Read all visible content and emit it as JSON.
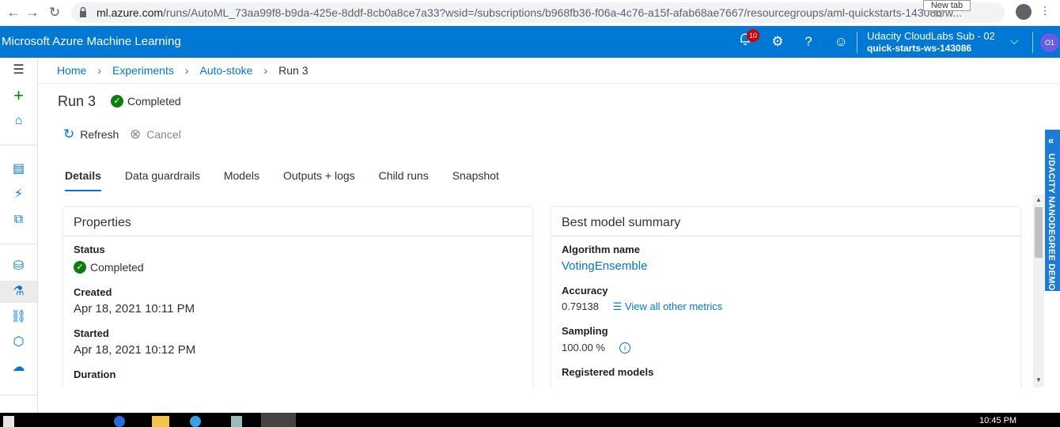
{
  "browser": {
    "url_domain": "ml.azure.com",
    "url_path": "/runs/AutoML_73aa99f8-b9da-425e-8ddf-8cb0a8ce7a33?wsid=/subscriptions/b968fb36-f06a-4c76-a15f-afab68ae7667/resourcegroups/aml-quickstarts-143086/w...",
    "tooltip": "New tab",
    "icons": [
      "back-arrow-icon",
      "forward-arrow-icon",
      "reload-icon",
      "lock-icon",
      "star-icon",
      "profile-icon",
      "more-icon"
    ]
  },
  "header": {
    "app_title": "Microsoft Azure Machine Learning",
    "notification_count": "10",
    "account_subscription": "Udacity CloudLabs Sub - 02",
    "account_workspace": "quick-starts-ws-143086",
    "avatar_initials": "O1",
    "accent_color": "#0078d4"
  },
  "breadcrumb": {
    "home": "Home",
    "experiments": "Experiments",
    "experiment": "Auto-stoke",
    "current": "Run 3"
  },
  "run": {
    "title": "Run 3",
    "status": "Completed",
    "status_color": "#107c10"
  },
  "commands": {
    "refresh": "Refresh",
    "cancel": "Cancel"
  },
  "tabs": [
    {
      "label": "Details",
      "active": true
    },
    {
      "label": "Data guardrails"
    },
    {
      "label": "Models"
    },
    {
      "label": "Outputs + logs"
    },
    {
      "label": "Child runs"
    },
    {
      "label": "Snapshot"
    }
  ],
  "properties": {
    "title": "Properties",
    "status_label": "Status",
    "status_value": "Completed",
    "created_label": "Created",
    "created_value": "Apr 18, 2021 10:11 PM",
    "started_label": "Started",
    "started_value": "Apr 18, 2021 10:12 PM",
    "duration_label": "Duration"
  },
  "best_model": {
    "title": "Best model summary",
    "algorithm_label": "Algorithm name",
    "algorithm_value": "VotingEnsemble",
    "accuracy_label": "Accuracy",
    "accuracy_value": "0.79138",
    "metrics_link": "View all other metrics",
    "sampling_label": "Sampling",
    "sampling_value": "100.00 %",
    "registered_label": "Registered models"
  },
  "side_badge": "UDACITY NANODEGREE DEMO",
  "taskbar": {
    "time": "10:45 PM"
  }
}
